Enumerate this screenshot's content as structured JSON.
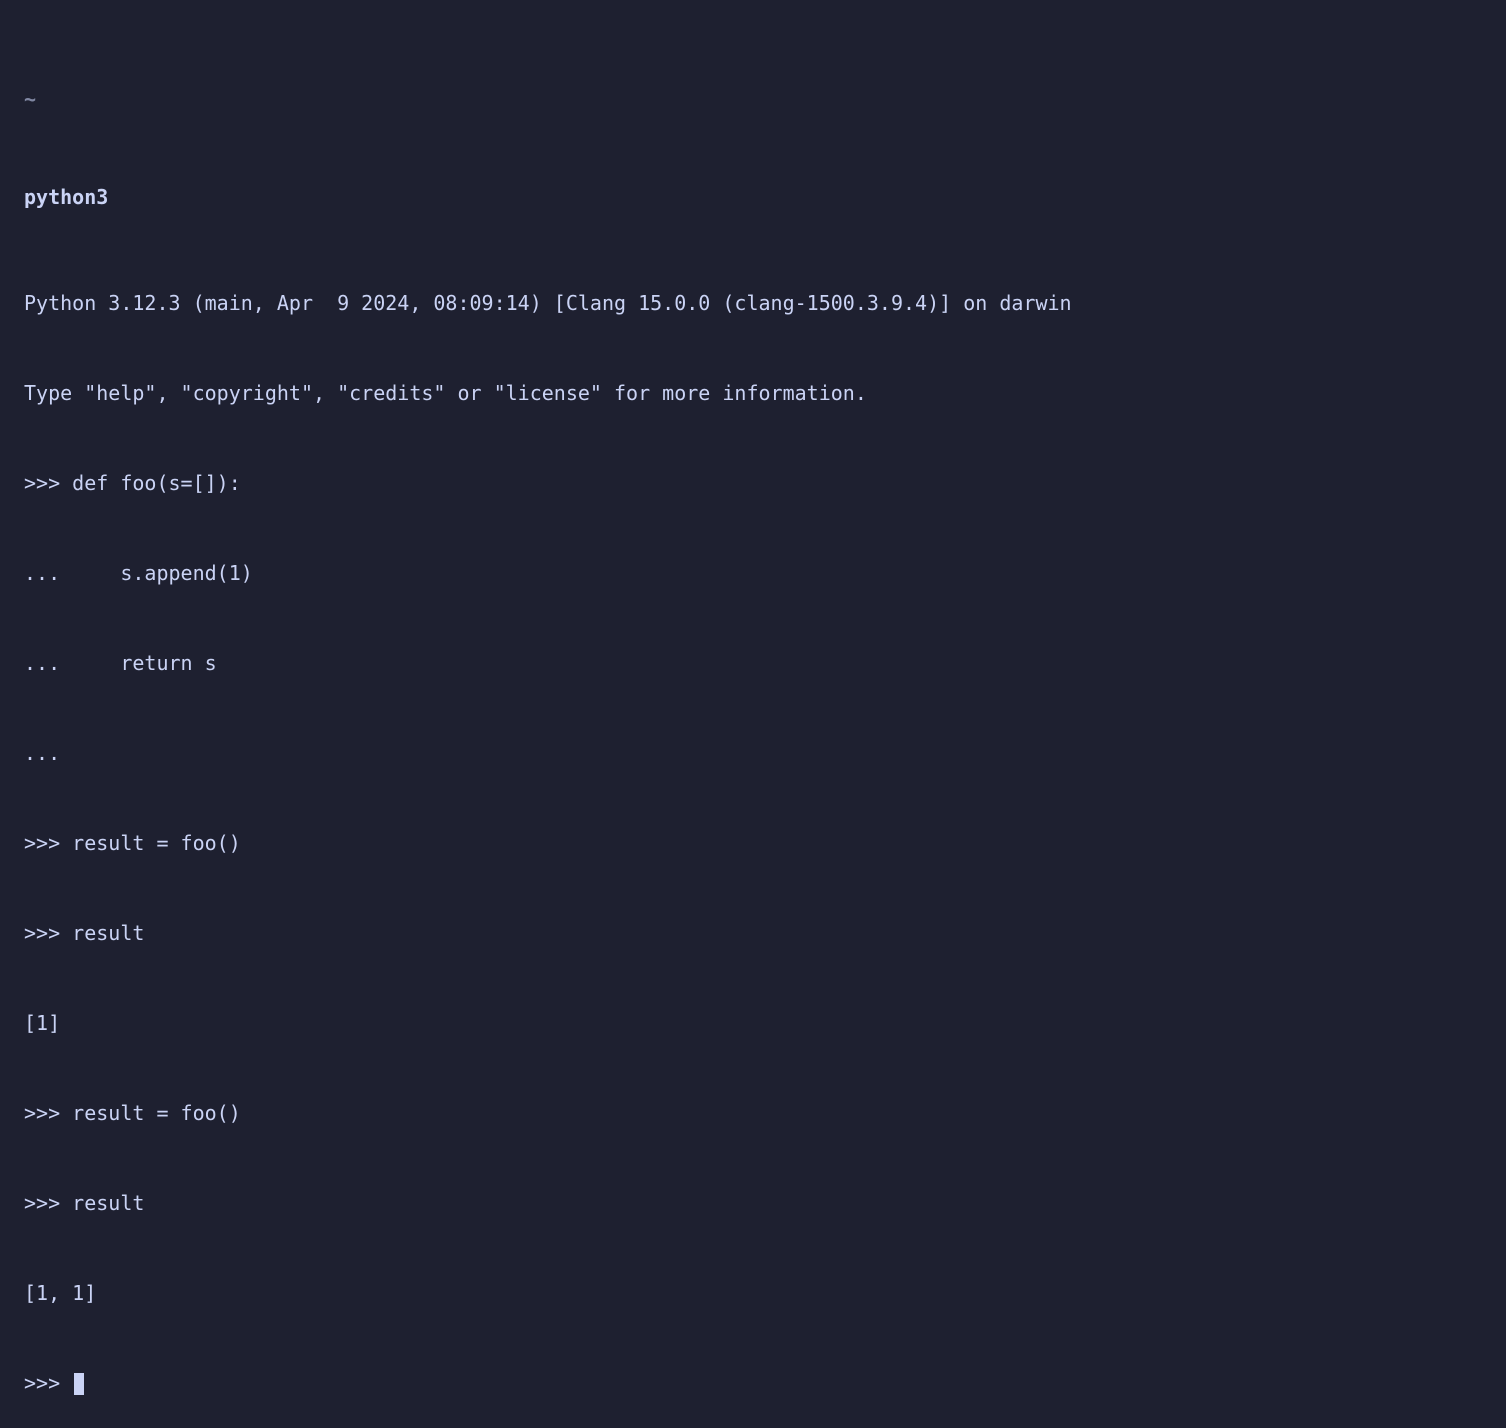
{
  "prompt_path": "~",
  "command": "python3",
  "banner_line1": "Python 3.12.3 (main, Apr  9 2024, 08:09:14) [Clang 15.0.0 (clang-1500.3.9.4)] on darwin",
  "banner_line2": "Type \"help\", \"copyright\", \"credits\" or \"license\" for more information.",
  "repl_lines": [
    ">>> def foo(s=[]):",
    "...     s.append(1)",
    "...     return s",
    "...",
    ">>> result = foo()",
    ">>> result",
    "[1]",
    ">>> result = foo()",
    ">>> result",
    "[1, 1]"
  ],
  "final_prompt": ">>> "
}
